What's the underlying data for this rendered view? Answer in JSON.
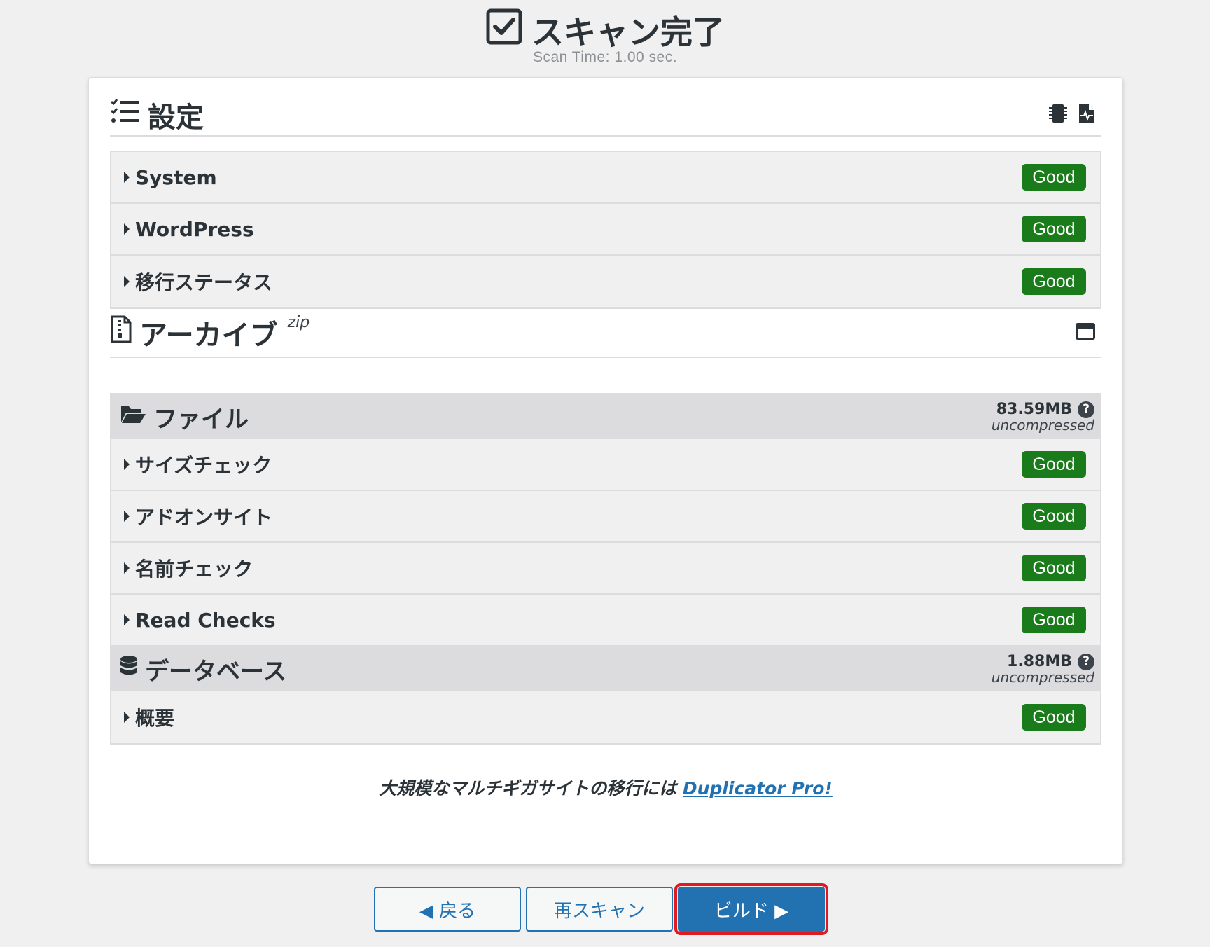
{
  "header": {
    "title": "スキャン完了",
    "scan_time": "Scan Time: 1.00 sec."
  },
  "settings": {
    "title": "設定",
    "rows": [
      {
        "label": "System",
        "status": "Good"
      },
      {
        "label": "WordPress",
        "status": "Good"
      },
      {
        "label": "移行ステータス",
        "status": "Good"
      }
    ]
  },
  "archive": {
    "title": "アーカイブ",
    "format": "zip",
    "files": {
      "title": "ファイル",
      "size": "83.59MB",
      "size_note": "uncompressed",
      "help": "?",
      "rows": [
        {
          "label": "サイズチェック",
          "status": "Good"
        },
        {
          "label": "アドオンサイト",
          "status": "Good"
        },
        {
          "label": "名前チェック",
          "status": "Good"
        },
        {
          "label": "Read Checks",
          "status": "Good"
        }
      ]
    },
    "database": {
      "title": "データベース",
      "size": "1.88MB",
      "size_note": "uncompressed",
      "help": "?",
      "rows": [
        {
          "label": "概要",
          "status": "Good"
        }
      ]
    }
  },
  "promo": {
    "text": "大規模なマルチギガサイトの移行には ",
    "link": "Duplicator Pro!"
  },
  "buttons": {
    "back": "◀ 戻る",
    "rescan": "再スキャン",
    "build": "ビルド ▶"
  },
  "colors": {
    "good": "#1a7b1a",
    "accent": "#2271b1",
    "highlight": "#e01a22"
  }
}
